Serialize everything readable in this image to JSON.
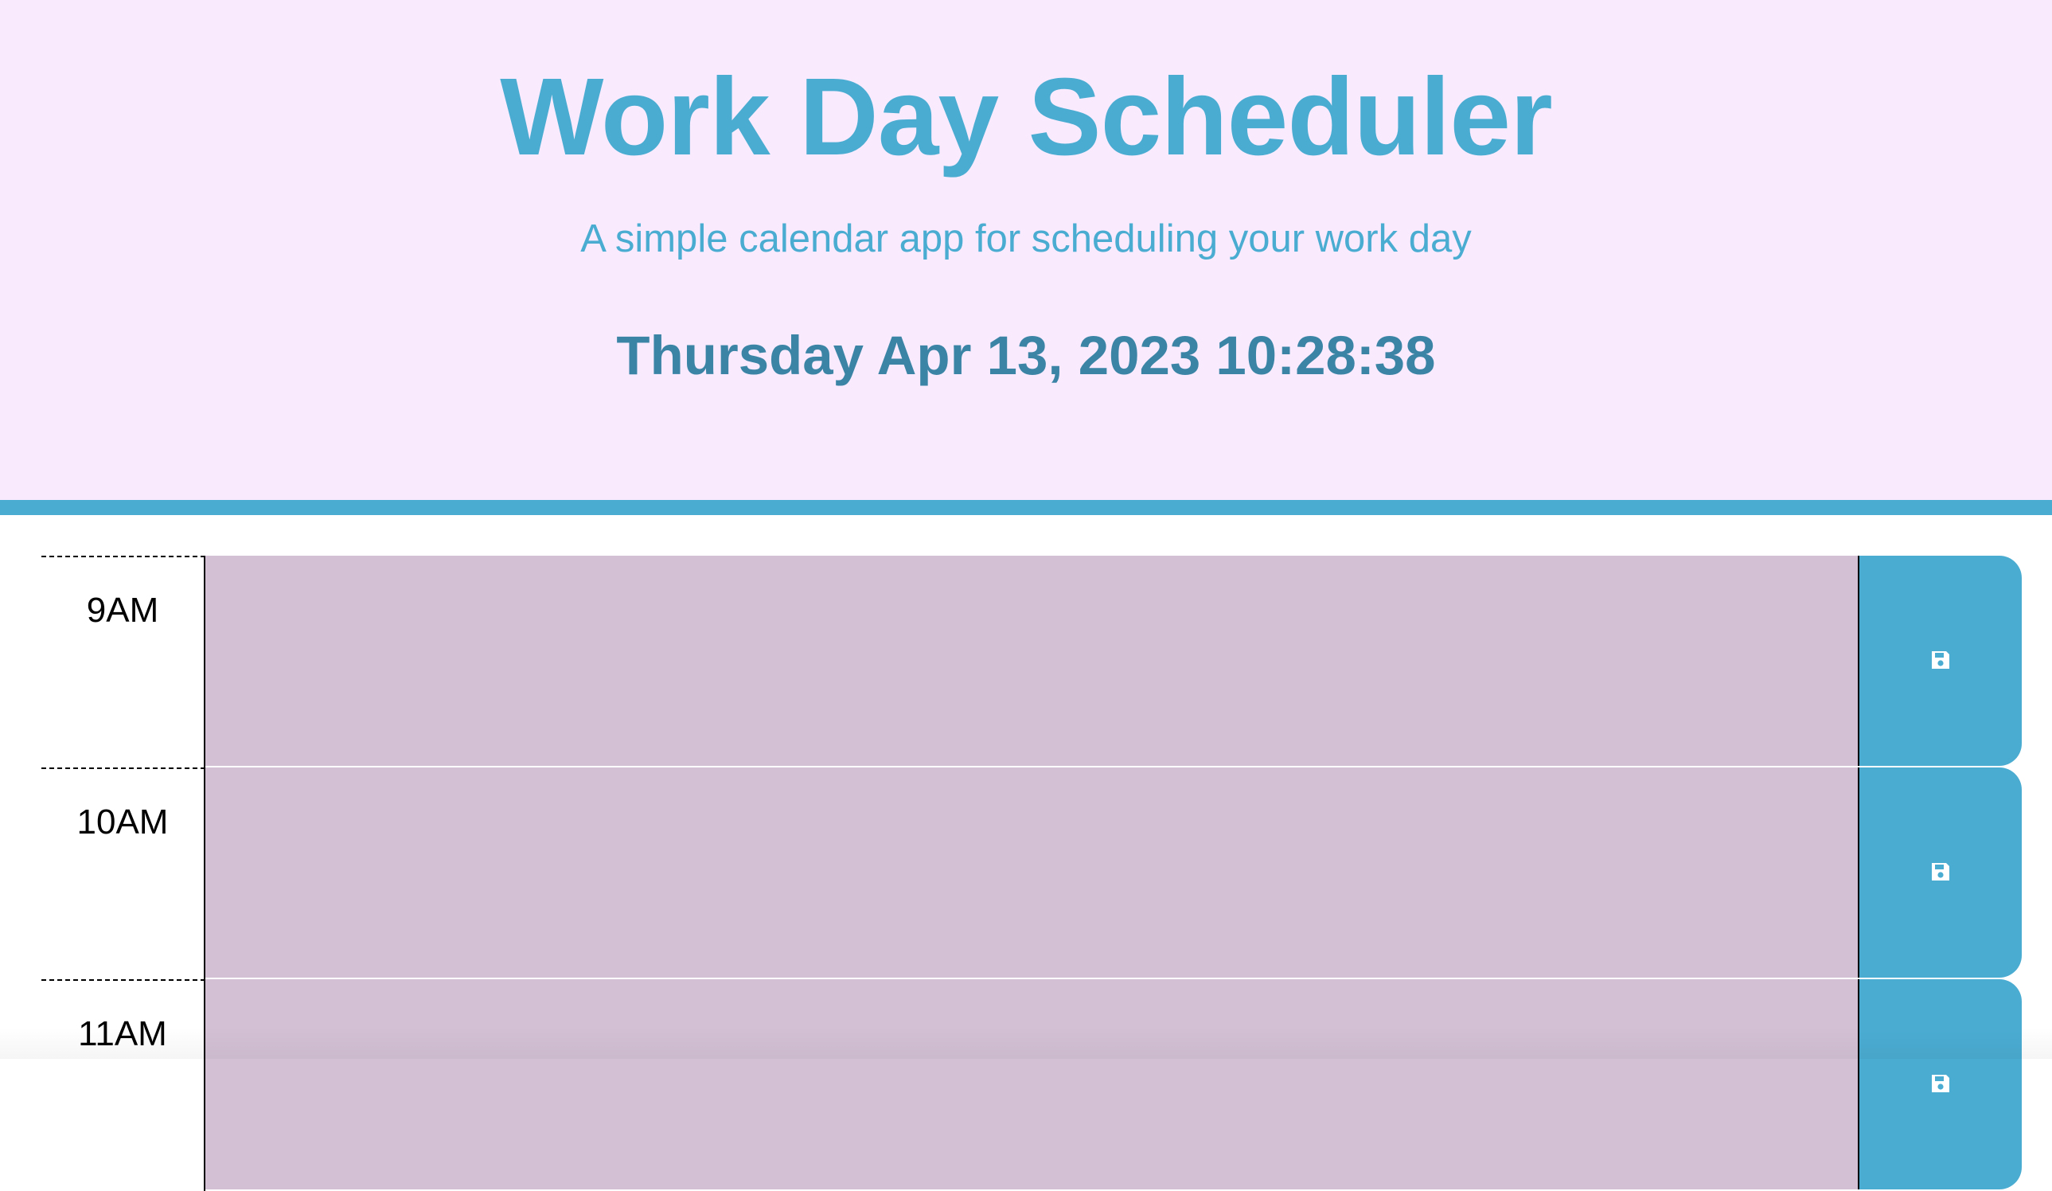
{
  "header": {
    "title": "Work Day Scheduler",
    "subtitle": "A simple calendar app for scheduling your work day",
    "current_datetime": "Thursday Apr 13, 2023 10:28:38"
  },
  "colors": {
    "header_background": "#f9ebfd",
    "accent": "#4bacd2",
    "date_text": "#3b84a6",
    "past_block": "#d3c0d5"
  },
  "time_blocks": [
    {
      "hour_label": "9AM",
      "text": "",
      "status": "past",
      "save_icon": "floppy-disk-icon"
    },
    {
      "hour_label": "10AM",
      "text": "",
      "status": "past",
      "save_icon": "floppy-disk-icon"
    },
    {
      "hour_label": "11AM",
      "text": "",
      "status": "past",
      "save_icon": "floppy-disk-icon"
    }
  ]
}
